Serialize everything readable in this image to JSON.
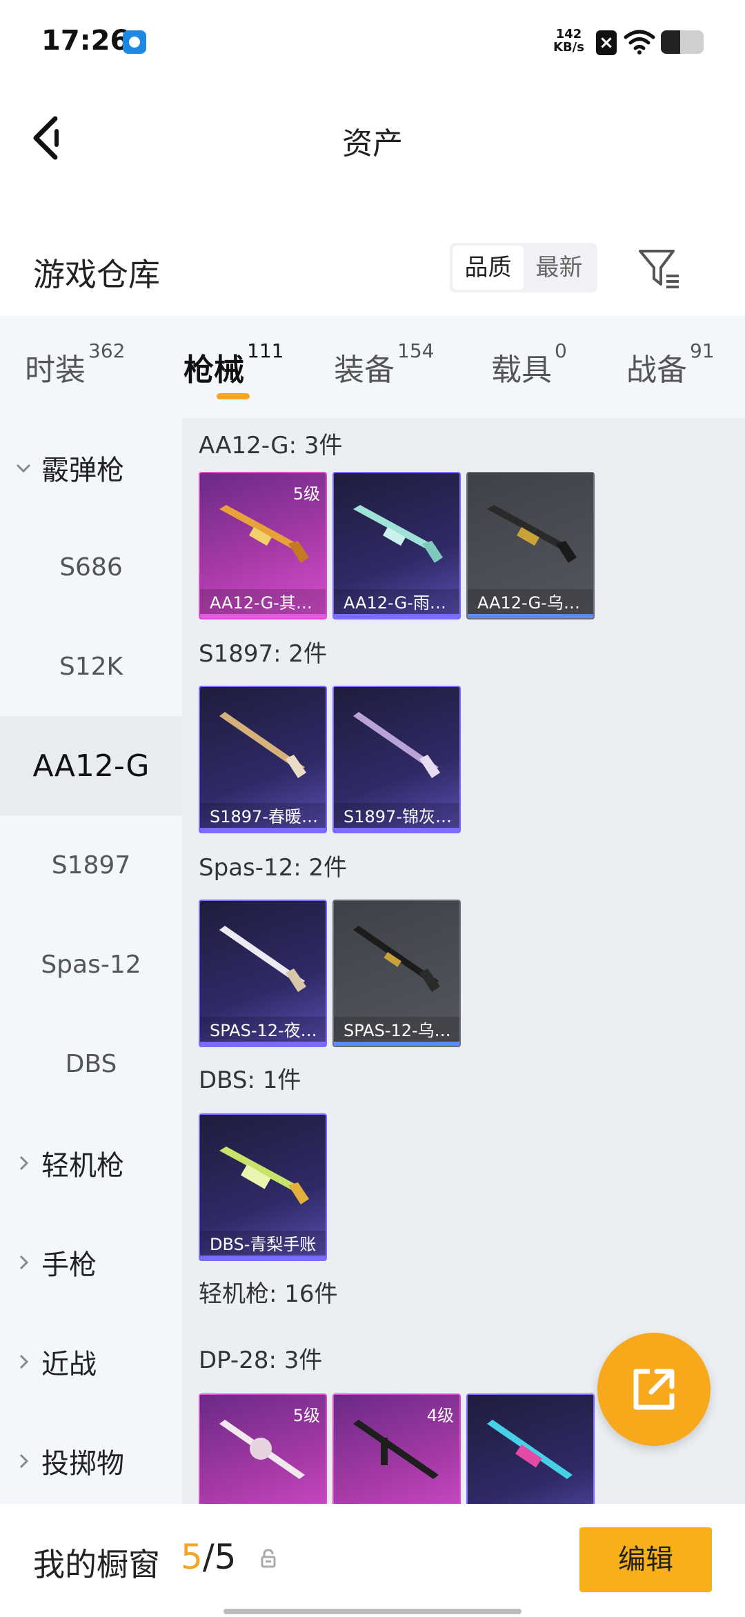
{
  "status_bar": {
    "time": "17:26",
    "net_speed_value": "142",
    "net_speed_unit": "KB/s",
    "battery_level": 0.45
  },
  "header": {
    "title": "资产",
    "back_icon": "chevron-left-icon"
  },
  "warehouse": {
    "title": "游戏仓库",
    "sort_options": [
      "品质",
      "最新"
    ],
    "active_sort": "品质",
    "filter_icon": "filter-icon"
  },
  "tabs": [
    {
      "label": "时装",
      "count": "362"
    },
    {
      "label": "枪械",
      "count": "111",
      "active": true
    },
    {
      "label": "装备",
      "count": "154"
    },
    {
      "label": "载具",
      "count": "0"
    },
    {
      "label": "战备",
      "count": "91"
    }
  ],
  "sidebar": {
    "items": [
      {
        "label": "霰弹枪",
        "type": "group",
        "expanded": true
      },
      {
        "label": "S686",
        "type": "sub"
      },
      {
        "label": "S12K",
        "type": "sub"
      },
      {
        "label": "AA12-G",
        "type": "sub",
        "selected": true
      },
      {
        "label": "S1897",
        "type": "sub"
      },
      {
        "label": "Spas-12",
        "type": "sub"
      },
      {
        "label": "DBS",
        "type": "sub"
      },
      {
        "label": "轻机枪",
        "type": "group",
        "expanded": false
      },
      {
        "label": "手枪",
        "type": "group",
        "expanded": false
      },
      {
        "label": "近战",
        "type": "group",
        "expanded": false
      },
      {
        "label": "投掷物",
        "type": "group",
        "expanded": false
      }
    ]
  },
  "content": {
    "groups": [
      {
        "title": "AA12-G: 3件",
        "items": [
          {
            "name": "AA12-G-其…",
            "level": "5级",
            "rarity": "purple"
          },
          {
            "name": "AA12-G-雨…",
            "level": "",
            "rarity": "blue"
          },
          {
            "name": "AA12-G-乌…",
            "level": "",
            "rarity": "gray"
          }
        ]
      },
      {
        "title": "S1897: 2件",
        "items": [
          {
            "name": "S1897-春暖…",
            "level": "",
            "rarity": "blue"
          },
          {
            "name": "S1897-锦灰…",
            "level": "",
            "rarity": "blue"
          }
        ]
      },
      {
        "title": "Spas-12: 2件",
        "items": [
          {
            "name": "SPAS-12-夜…",
            "level": "",
            "rarity": "blue"
          },
          {
            "name": "SPAS-12-乌…",
            "level": "",
            "rarity": "gray"
          }
        ]
      },
      {
        "title": "DBS: 1件",
        "items": [
          {
            "name": "DBS-青梨手账",
            "level": "",
            "rarity": "blue"
          }
        ]
      },
      {
        "title": "轻机枪: 16件",
        "items": []
      },
      {
        "title": "DP-28: 3件",
        "items": [
          {
            "name": "",
            "level": "5级",
            "rarity": "purple"
          },
          {
            "name": "",
            "level": "4级",
            "rarity": "purple"
          },
          {
            "name": "",
            "level": "",
            "rarity": "blue"
          }
        ]
      }
    ]
  },
  "fab": {
    "icon": "share-external-icon"
  },
  "bottom_bar": {
    "my_window_label": "我的橱窗",
    "count_used": "5",
    "count_total": "/5",
    "lock_icon": "lock-icon",
    "edit_label": "编辑"
  },
  "colors": {
    "accent": "#f5a623",
    "edit_button": "#f8b01a",
    "rarity_purple": "#d84fd1",
    "rarity_blue": "#7a6cff",
    "rarity_gray": "#6e6e78"
  }
}
